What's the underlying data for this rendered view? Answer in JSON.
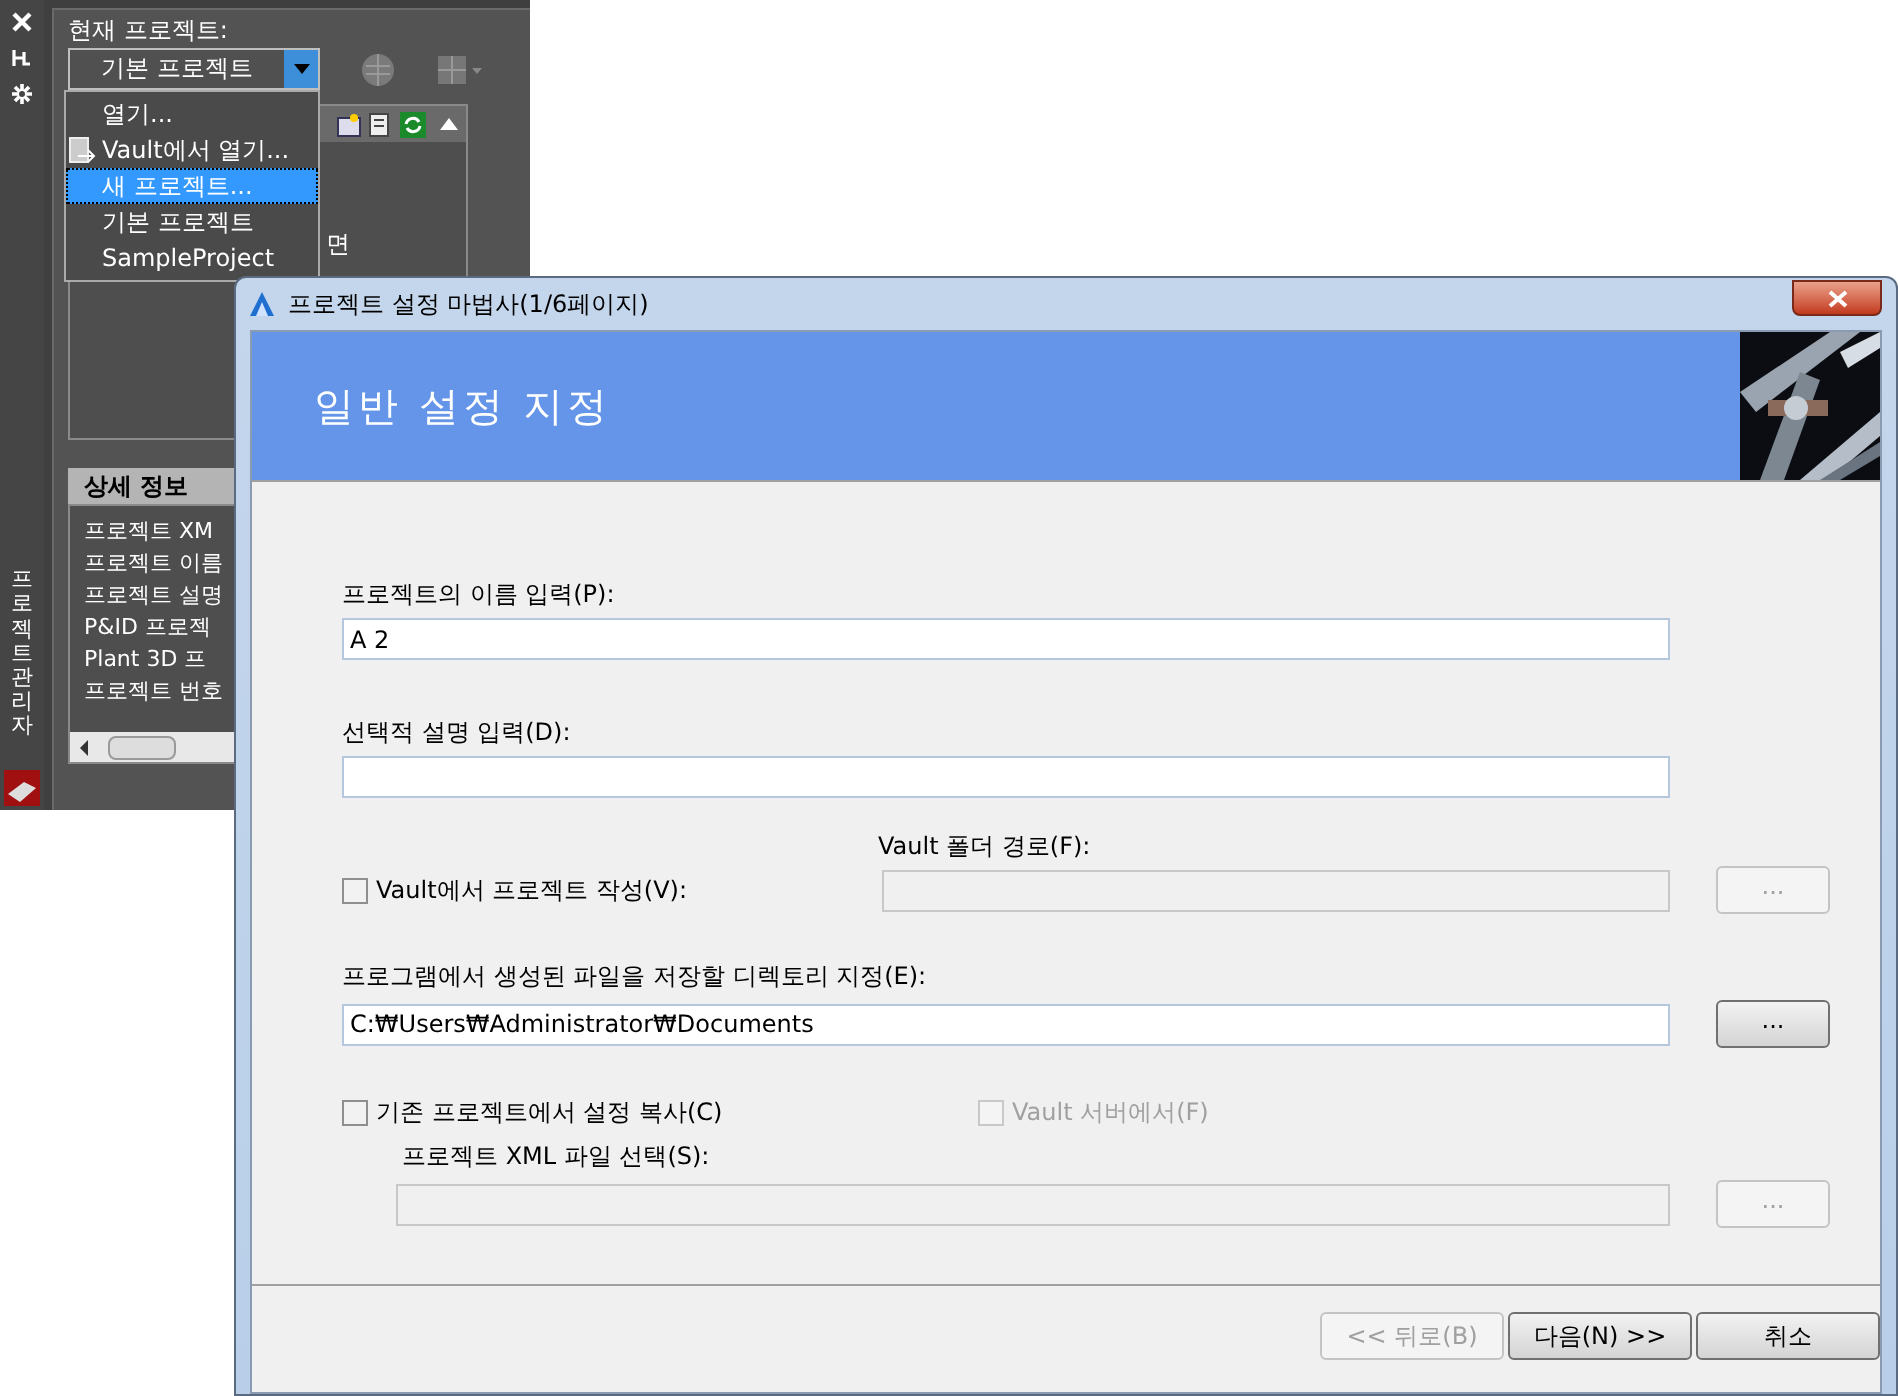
{
  "side_panel": {
    "vertical_tab": "프로젝트 관리자",
    "title": "현재 프로젝트:",
    "project_select": {
      "value": "기본 프로젝트"
    },
    "menu": [
      {
        "label": "열기...",
        "kind": "plain",
        "selected": false
      },
      {
        "label": "Vault에서 열기...",
        "kind": "vault",
        "selected": false
      },
      {
        "label": "새 프로젝트...",
        "kind": "plain",
        "selected": true
      },
      {
        "label": "기본 프로젝트",
        "kind": "plain",
        "selected": false
      },
      {
        "label": "SampleProject",
        "kind": "plain",
        "selected": false
      }
    ],
    "tree_fragment": "면",
    "details": {
      "title": "상세 정보",
      "rows": [
        "프로젝트 XM",
        "프로젝트 이름",
        "프로젝트 설명",
        "P&ID 프로젝",
        "Plant 3D 프",
        "프로젝트 번호"
      ]
    }
  },
  "dialog": {
    "title": "프로젝트 설정 마법사(1/6페이지)",
    "heading": "일반 설정 지정",
    "name": {
      "label": "프로젝트의 이름 입력(P):",
      "value": "A 2"
    },
    "description": {
      "label": "선택적 설명 입력(D):"
    },
    "vault": {
      "label": "Vault에서 프로젝트 작성(V):",
      "checked": false,
      "folder_label": "Vault 폴더 경로(F):",
      "browse": {
        "label": "...",
        "disabled": true
      }
    },
    "directory": {
      "label": "프로그램에서 생성된 파일을 저장할 디렉토리 지정(E):",
      "value": "C:₩Users₩Administrator₩Documents",
      "browse": {
        "label": "...",
        "disabled": false
      }
    },
    "copy": {
      "label": "기존 프로젝트에서 설정 복사(C)",
      "checked": false,
      "vault_server": {
        "label": "Vault 서버에서(F)",
        "checked": false,
        "disabled": true
      },
      "xml_label": "프로젝트 XML 파일 선택(S):",
      "browse": {
        "label": "...",
        "disabled": true
      }
    },
    "buttons": [
      {
        "label": "<< 뒤로(B)",
        "disabled": true
      },
      {
        "label": "다음(N) >>",
        "disabled": false
      },
      {
        "label": "취소",
        "disabled": false
      }
    ]
  }
}
